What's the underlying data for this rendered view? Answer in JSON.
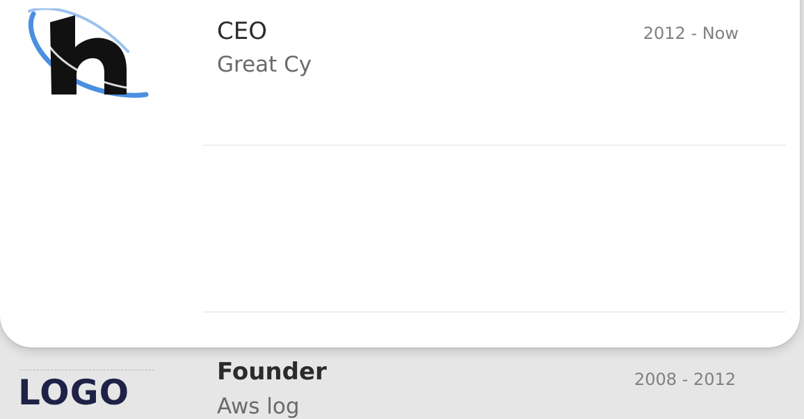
{
  "experience": {
    "items": [
      {
        "title": "CEO",
        "company": "Great Cy",
        "dates": "2012 - Now",
        "logo_icon": "h-letter-swoosh-logo"
      },
      {
        "title": "Founder",
        "company": "Aws log",
        "dates": "2008 - 2012",
        "logo_icon": "logo-wordmark",
        "logo_text": "LOGO"
      }
    ]
  },
  "colors": {
    "card_background": "#ffffff",
    "page_background": "#e6e6e6",
    "title_text": "#2b2b2b",
    "company_text": "#6a6a6a",
    "date_text": "#808080",
    "logo_wordmark": "#1f2247",
    "logo_swoosh": "#4a8fe0"
  }
}
